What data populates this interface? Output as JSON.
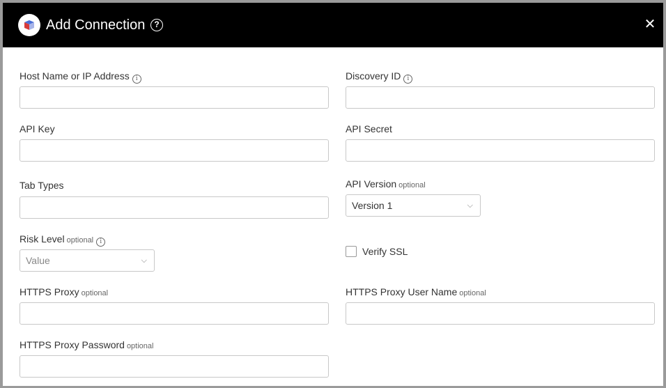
{
  "header": {
    "title": "Add Connection",
    "help_glyph": "?",
    "close_glyph": "✕"
  },
  "fields": {
    "host": {
      "label": "Host Name or IP Address",
      "value": ""
    },
    "discovery": {
      "label": "Discovery ID",
      "value": ""
    },
    "api_key": {
      "label": "API Key",
      "value": ""
    },
    "api_secret": {
      "label": "API Secret",
      "value": ""
    },
    "tab_types": {
      "label": "Tab Types",
      "value": ""
    },
    "api_version": {
      "label": "API Version",
      "optional": "optional",
      "value": "Version 1"
    },
    "risk_level": {
      "label": "Risk Level",
      "optional": "optional",
      "placeholder": "Value"
    },
    "verify_ssl": {
      "label": "Verify SSL",
      "checked": false
    },
    "https_proxy": {
      "label": "HTTPS Proxy",
      "optional": "optional",
      "value": ""
    },
    "https_proxy_user": {
      "label": "HTTPS Proxy User Name",
      "optional": "optional",
      "value": ""
    },
    "https_proxy_password": {
      "label": "HTTPS Proxy Password",
      "optional": "optional",
      "value": ""
    }
  },
  "icons": {
    "info_glyph": "i",
    "chevron_glyph": "⌵"
  },
  "colors": {
    "header_bg": "#000000",
    "frame_border": "#9a9a9a"
  }
}
